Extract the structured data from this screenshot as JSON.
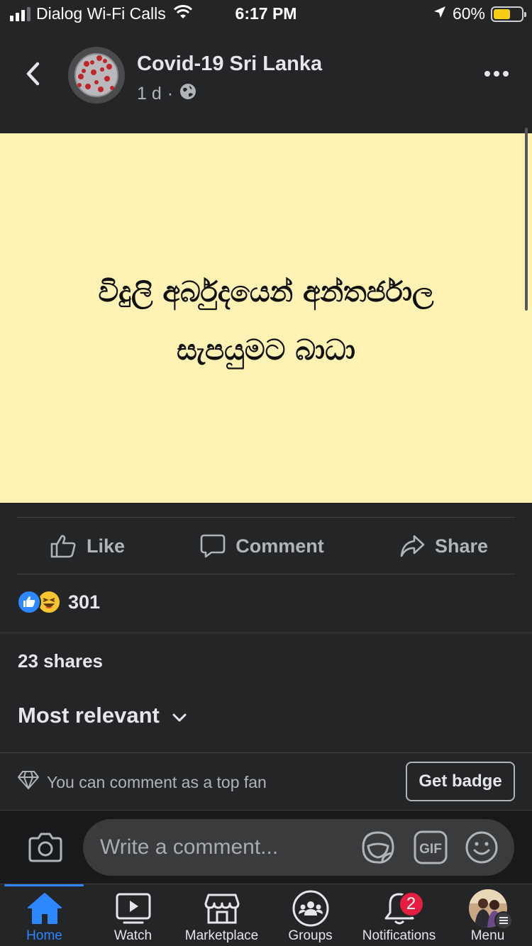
{
  "status_bar": {
    "carrier": "Dialog Wi-Fi Calls",
    "time": "6:17 PM",
    "battery_percent": "60%",
    "battery_level": 0.6,
    "signal_bars": 3
  },
  "post": {
    "page_name": "Covid-19 Sri Lanka",
    "time_ago": "1 d",
    "separator": "·",
    "audience_icon": "globe-icon",
    "content_line1": "විදුලි අර්බුදයෙන් අන්තර්ජාල",
    "content_line2": "සැපයුමට බාධා",
    "content_background": "#fdf2b3"
  },
  "actions": {
    "like": "Like",
    "comment": "Comment",
    "share": "Share"
  },
  "reactions": {
    "count": "301",
    "types": [
      "like-reaction-icon",
      "haha-reaction-icon"
    ]
  },
  "shares": "23 shares",
  "sort": {
    "label": "Most relevant"
  },
  "top_fan": {
    "text": "You can comment as a top fan",
    "button": "Get badge"
  },
  "composer": {
    "placeholder": "Write a comment...",
    "gif_label": "GIF"
  },
  "tabs": [
    {
      "label": "Home",
      "icon": "home-icon",
      "active": true
    },
    {
      "label": "Watch",
      "icon": "watch-icon"
    },
    {
      "label": "Marketplace",
      "icon": "marketplace-icon"
    },
    {
      "label": "Groups",
      "icon": "groups-icon"
    },
    {
      "label": "Notifications",
      "icon": "bell-icon",
      "badge": "2"
    },
    {
      "label": "Menu",
      "icon": "profile-avatar"
    }
  ],
  "colors": {
    "accent": "#2d88ff",
    "background": "#242526",
    "badge": "#e41e3f",
    "battery": "#f6ce17"
  }
}
